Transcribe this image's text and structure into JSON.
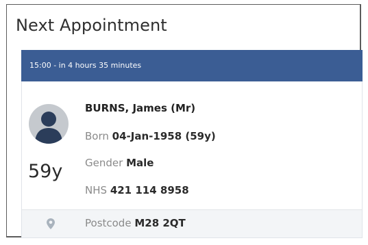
{
  "panel": {
    "title": "Next Appointment"
  },
  "appointment": {
    "time_text": "15:00 - in 4 hours 35 minutes"
  },
  "patient": {
    "name": "BURNS, James (Mr)",
    "age_display": "59y",
    "born_label": "Born",
    "born_value": "04-Jan-1958 (59y)",
    "gender_label": "Gender",
    "gender_value": "Male",
    "nhs_label": "NHS",
    "nhs_value": "421 114 8958",
    "postcode_label": "Postcode",
    "postcode_value": "M28 2QT"
  },
  "icons": {
    "avatar": "person-silhouette-icon",
    "location": "map-pin-icon"
  },
  "colors": {
    "header_bg": "#3b5d94",
    "header_text": "#ffffff",
    "avatar_bg": "#c5c9ce",
    "avatar_figure": "#2b3d5a",
    "pin": "#a9b3bd",
    "footer_bg": "#f3f5f7"
  }
}
